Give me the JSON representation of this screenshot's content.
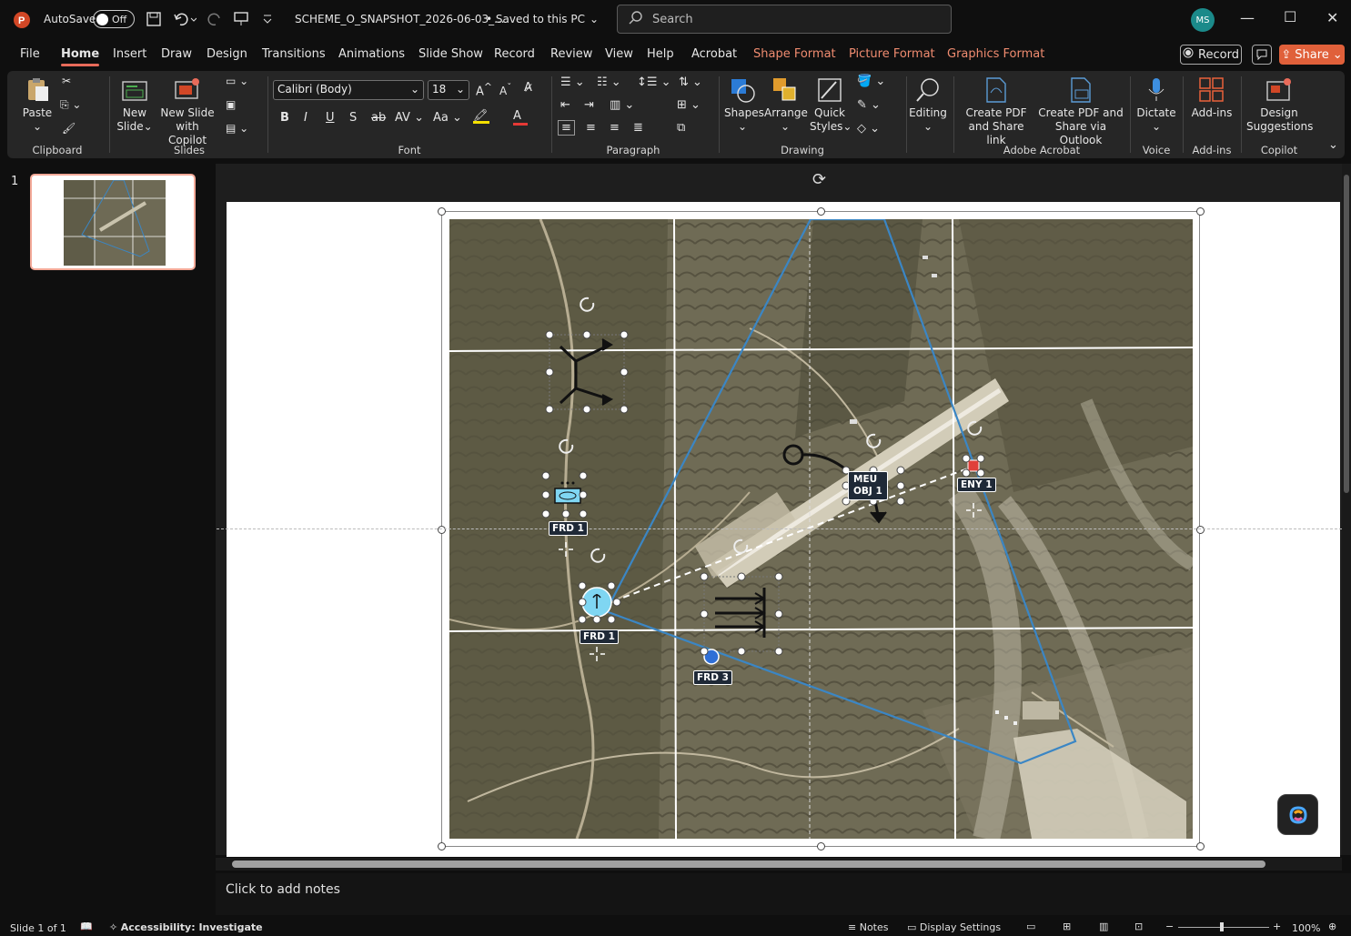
{
  "title": {
    "autosave_label": "AutoSave",
    "autosave_state": "Off",
    "filename": "SCHEME_O_SNAPSHOT_2026-06-03_...",
    "save_status": "• Saved to this PC",
    "search_placeholder": "Search",
    "user_initials": "MS"
  },
  "menu": {
    "tabs": [
      "File",
      "Home",
      "Insert",
      "Draw",
      "Design",
      "Transitions",
      "Animations",
      "Slide Show",
      "Record",
      "Review",
      "View",
      "Help",
      "Acrobat",
      "Shape Format",
      "Picture Format",
      "Graphics Format"
    ],
    "active_tab": "Home",
    "record_label": "Record",
    "share_label": "Share"
  },
  "ribbon": {
    "clipboard": {
      "paste": "Paste",
      "group": "Clipboard"
    },
    "slides": {
      "new_slide": "New Slide",
      "new_slide_line1": "New",
      "new_slide_line2": "Slide",
      "copilot_line1": "New Slide",
      "copilot_line2": "with Copilot",
      "group": "Slides"
    },
    "font": {
      "family": "Calibri (Body)",
      "size": "18",
      "bold": "B",
      "italic": "I",
      "underline": "U",
      "shadow": "S",
      "strike": "ab",
      "spacing": "AV",
      "case": "Aa",
      "grow": "A",
      "shrink": "A",
      "group": "Font"
    },
    "paragraph": {
      "group": "Paragraph"
    },
    "drawing": {
      "shapes": "Shapes",
      "arrange": "Arrange",
      "quick1": "Quick",
      "quick2": "Styles",
      "group": "Drawing"
    },
    "editing": {
      "label": "Editing"
    },
    "acrobat": {
      "pdf1_line1": "Create PDF",
      "pdf1_line2": "and Share link",
      "pdf2_line1": "Create PDF and",
      "pdf2_line2": "Share via Outlook",
      "group": "Adobe Acrobat"
    },
    "voice": {
      "dictate": "Dictate",
      "group": "Voice"
    },
    "addins": {
      "label": "Add-ins",
      "group": "Add-ins"
    },
    "copilot": {
      "line1": "Design",
      "line2": "Suggestions",
      "group": "Copilot"
    }
  },
  "thumbnails": {
    "slide_number": "1"
  },
  "map": {
    "labels": {
      "frd1_top": "FRD 1",
      "frd1_main": "FRD 1",
      "frd3": "FRD 3",
      "meu_obj_line1": "MEU",
      "meu_obj_line2": "OBJ 1",
      "eny1": "ENY 1"
    },
    "colors": {
      "boundary": "#3b86c4",
      "friendly": "#7fd6f2",
      "enemy": "#e0403a",
      "frd3": "#2f6fd6"
    }
  },
  "notes": {
    "placeholder": "Click to add notes"
  },
  "status": {
    "slide_info": "Slide 1 of 1",
    "accessibility": "Accessibility: Investigate",
    "notes": "Notes",
    "display_settings": "Display Settings",
    "zoom": "100%"
  }
}
